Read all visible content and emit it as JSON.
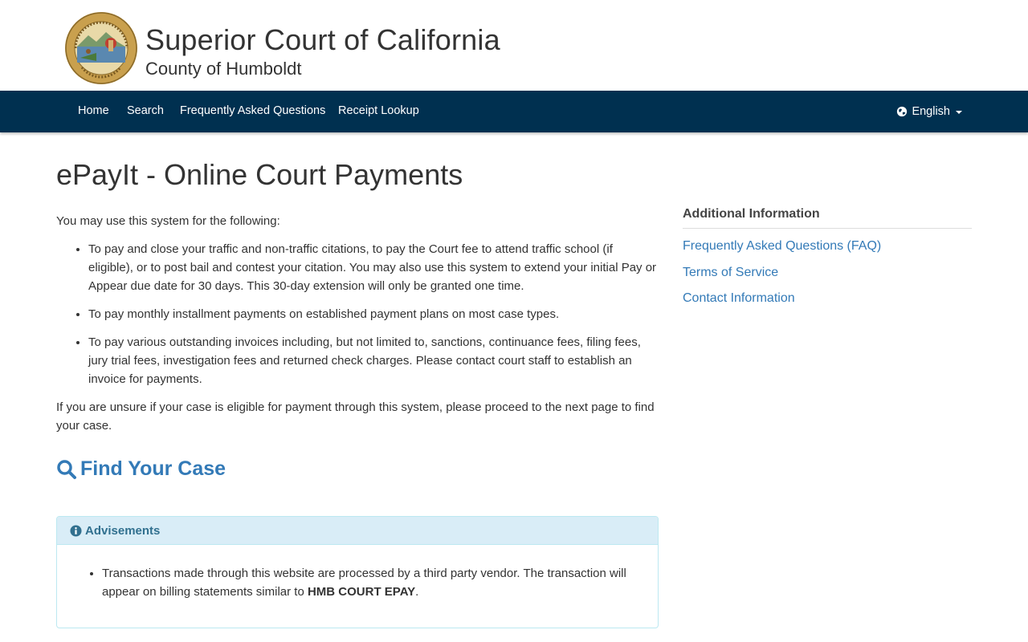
{
  "header": {
    "title": "Superior Court of California",
    "subtitle": "County of Humboldt",
    "seal_icon": "state-seal-icon"
  },
  "nav": {
    "items": [
      "Home",
      "Search",
      "Frequently Asked Questions",
      "Receipt Lookup"
    ],
    "language": "English",
    "background": "#003050"
  },
  "page": {
    "title": "ePayIt - Online Court Payments"
  },
  "main": {
    "intro": "You may use this system for the following:",
    "bullets": [
      "To pay and close your traffic and non-traffic citations, to pay the Court fee to attend traffic school (if eligible), or to post bail and contest your citation. You may also use this system to extend your initial Pay or Appear due date for 30 days. This 30-day extension will only be granted one time.",
      "To pay monthly installment payments on established payment plans on most case types.",
      "To pay various outstanding invoices including, but not limited to, sanctions, continuance fees, filing fees, jury trial fees, investigation fees and returned check charges. Please contact court staff to establish an invoice for payments."
    ],
    "outro": "If you are unsure if your case is eligible for payment through this system, please proceed to the next page to find your case.",
    "find_case": "Find Your Case"
  },
  "advisements": {
    "heading": "Advisements",
    "text_before": "Transactions made through this website are processed by a third party vendor. The transaction will appear on billing statements similar to ",
    "emphasis": "HMB COURT EPAY",
    "text_after": "."
  },
  "sidebar": {
    "heading": "Additional Information",
    "links": [
      "Frequently Asked Questions (FAQ)",
      "Terms of Service",
      "Contact Information"
    ]
  },
  "colors": {
    "link": "#337ab7",
    "panel_heading_bg": "#d9edf7",
    "panel_heading_text": "#31708f"
  }
}
